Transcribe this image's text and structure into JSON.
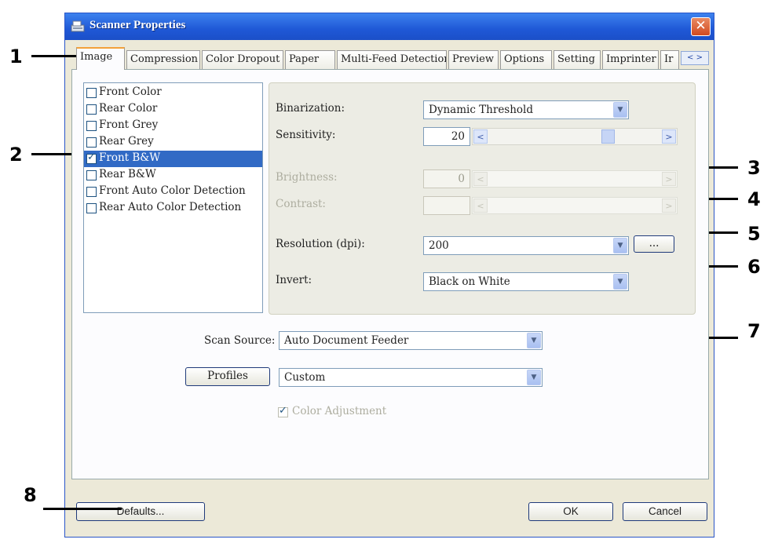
{
  "window": {
    "title": "Scanner Properties",
    "close_glyph": "✕"
  },
  "tabs": [
    {
      "label": "Image",
      "active": true
    },
    {
      "label": "Compression"
    },
    {
      "label": "Color Dropout"
    },
    {
      "label": "Paper"
    },
    {
      "label": "Multi-Feed Detection"
    },
    {
      "label": "Preview"
    },
    {
      "label": "Options"
    },
    {
      "label": "Setting"
    },
    {
      "label": "Imprinter"
    },
    {
      "label": "Ir"
    }
  ],
  "tab_scroll": {
    "left": "<",
    "right": ">"
  },
  "image_list": [
    {
      "label": "Front Color",
      "checked": false
    },
    {
      "label": "Rear Color",
      "checked": false
    },
    {
      "label": "Front Grey",
      "checked": false
    },
    {
      "label": "Rear Grey",
      "checked": false
    },
    {
      "label": "Front B&W",
      "checked": true,
      "selected": true
    },
    {
      "label": "Rear B&W",
      "checked": false
    },
    {
      "label": "Front Auto Color Detection",
      "checked": false
    },
    {
      "label": "Rear Auto Color Detection",
      "checked": false
    }
  ],
  "settings": {
    "binarization": {
      "label": "Binarization:",
      "value": "Dynamic Threshold"
    },
    "sensitivity": {
      "label": "Sensitivity:",
      "value": "20",
      "left": "<",
      "right": ">",
      "thumb": "|||"
    },
    "brightness": {
      "label": "Brightness:",
      "value": "0",
      "left": "<",
      "right": ">"
    },
    "contrast": {
      "label": "Contrast:",
      "value": "",
      "left": "<",
      "right": ">"
    },
    "resolution": {
      "label": "Resolution (dpi):",
      "value": "200",
      "more_button": "..."
    },
    "invert": {
      "label": "Invert:",
      "value": "Black on White"
    }
  },
  "scan_source": {
    "label": "Scan Source:",
    "value": "Auto Document Feeder"
  },
  "profiles": {
    "button_label": "Profiles",
    "value": "Custom"
  },
  "color_adjustment": {
    "label": "Color Adjustment",
    "checked": true
  },
  "buttons": {
    "defaults": "Defaults...",
    "ok": "OK",
    "cancel": "Cancel"
  },
  "callouts": [
    "1",
    "2",
    "3",
    "4",
    "5",
    "6",
    "7",
    "8"
  ],
  "icons": {
    "dropdown": "▼"
  },
  "colors": {
    "title_bar": "#1f58d6",
    "selection": "#316ac5",
    "close": "#d24a20",
    "dialog_bg": "#ece9d8"
  }
}
